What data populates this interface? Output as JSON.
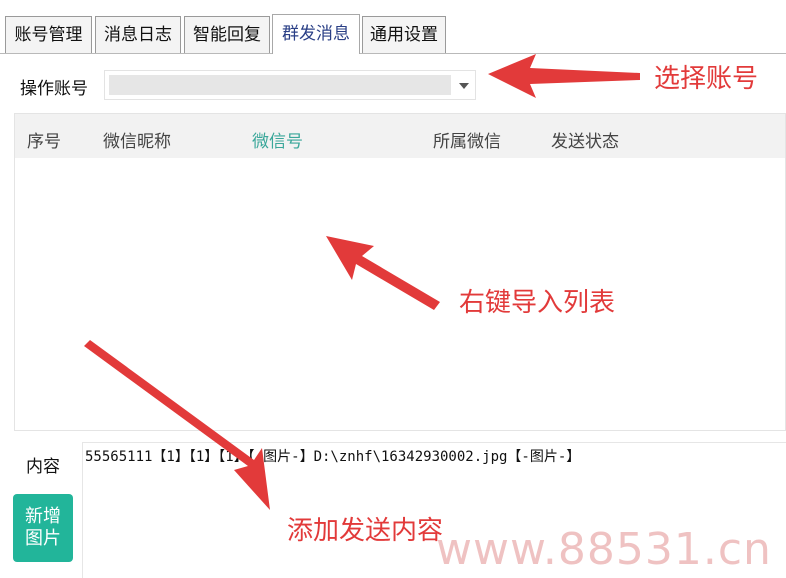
{
  "tabs": [
    {
      "label": "账号管理",
      "active": false
    },
    {
      "label": "消息日志",
      "active": false
    },
    {
      "label": "智能回复",
      "active": false
    },
    {
      "label": "群发消息",
      "active": true
    },
    {
      "label": "通用设置",
      "active": false
    }
  ],
  "account": {
    "label": "操作账号",
    "selected_value": ""
  },
  "list": {
    "columns": [
      "序号",
      "微信昵称",
      "微信号",
      "所属微信",
      "发送状态"
    ],
    "rows": []
  },
  "content": {
    "label": "内容",
    "text": "55565111【1】【1】【1】【-图片-】D:\\znhf\\16342930002.jpg【-图片-】",
    "add_image_button": "新增图片"
  },
  "annotations": {
    "select_account": "选择账号",
    "import_list": "右键导入列表",
    "add_content": "添加发送内容"
  },
  "watermark": "www.88531.cn",
  "colors": {
    "accent_green": "#22b59a",
    "annotation_red": "#e23a3a",
    "active_tab_text": "#2a3f86",
    "highlight_column": "#3aa79a"
  }
}
